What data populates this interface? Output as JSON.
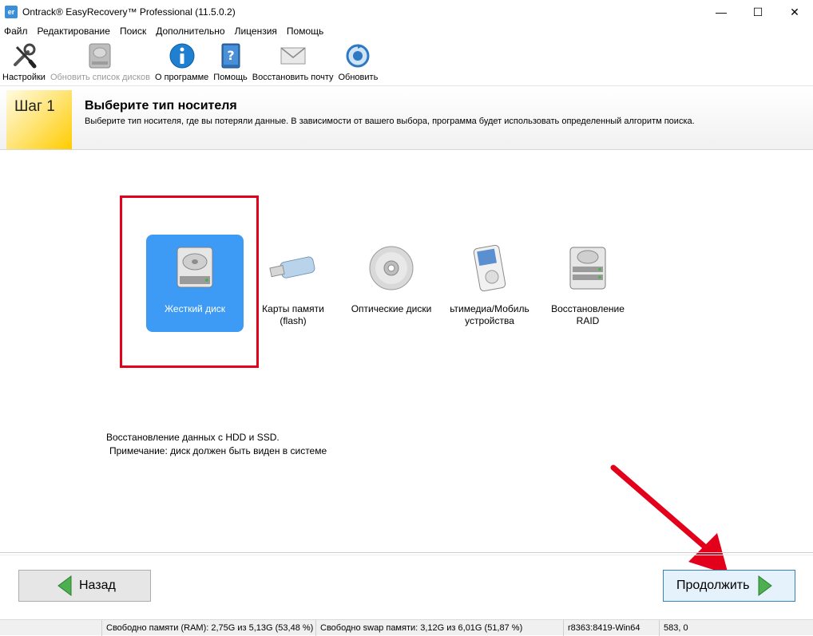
{
  "window": {
    "app_icon": "er",
    "title": "Ontrack® EasyRecovery™ Professional (11.5.0.2)",
    "minimize": "—",
    "maximize": "☐",
    "close": "✕"
  },
  "menu": [
    "Файл",
    "Редактирование",
    "Поиск",
    "Дополнительно",
    "Лицензия",
    "Помощь"
  ],
  "toolbar": {
    "settings": "Настройки",
    "refresh_disks": "Обновить список дисков",
    "about": "О программе",
    "help": "Помощь",
    "restore_mail": "Восстановить почту",
    "update": "Обновить"
  },
  "step": {
    "label": "Шаг 1",
    "title": "Выберите тип носителя",
    "description": "Выберите тип носителя, где вы потеряли данные. В зависимости от вашего выбора, программа будет использовать определенный алгоритм поиска."
  },
  "media": [
    {
      "label": "Жесткий диск",
      "icon": "hard-drive-icon",
      "selected": true
    },
    {
      "label": "Карты памяти\n(flash)",
      "icon": "usb-flash-icon",
      "selected": false
    },
    {
      "label": "Оптические диски",
      "icon": "optical-disc-icon",
      "selected": false
    },
    {
      "label": "ьтимедиа/Мобиль\nустройства",
      "icon": "media-player-icon",
      "selected": false
    },
    {
      "label": "Восстановление\nRAID",
      "icon": "raid-icon",
      "selected": false
    }
  ],
  "info": {
    "line1": "Восстановление данных с HDD и SSD.",
    "line2": "Примечание: диск должен быть виден в системе"
  },
  "buttons": {
    "back": "Назад",
    "next": "Продолжить"
  },
  "status": {
    "ram": "Свободно памяти (RAM): 2,75G из 5,13G (53,48 %)",
    "swap": "Свободно swap памяти: 3,12G из 6,01G (51,87 %)",
    "build": "r8363:8419-Win64",
    "coords": "583, 0"
  },
  "colors": {
    "selected_bg": "#3d9bf5",
    "highlight": "#e3001b",
    "step_accent": "#ffcc00",
    "arrow_green": "#4caf50"
  }
}
